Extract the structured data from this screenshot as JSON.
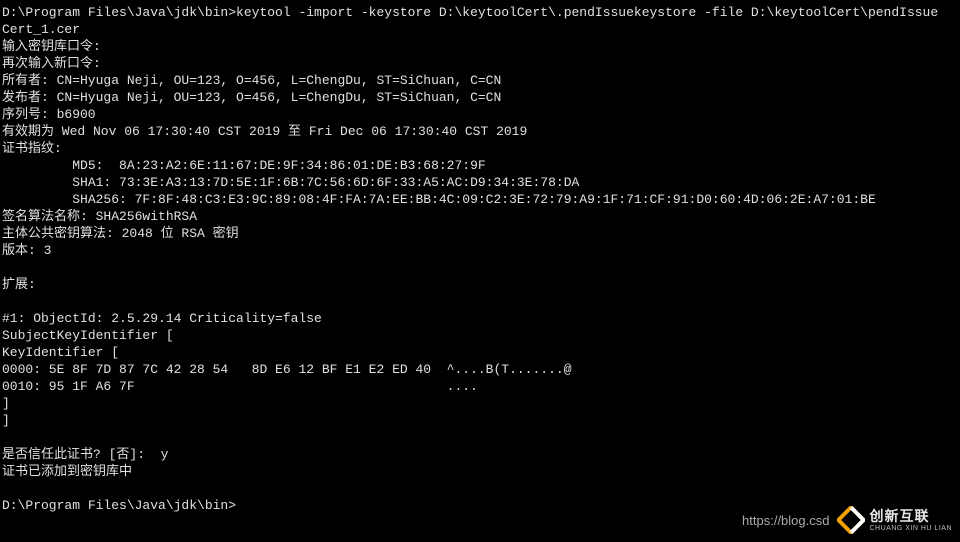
{
  "terminal": {
    "lines": [
      "D:\\Program Files\\Java\\jdk\\bin>keytool -import -keystore D:\\keytoolCert\\.pendIssuekeystore -file D:\\keytoolCert\\pendIssue",
      "Cert_1.cer",
      "输入密钥库口令:",
      "再次输入新口令:",
      "所有者: CN=Hyuga Neji, OU=123, O=456, L=ChengDu, ST=SiChuan, C=CN",
      "发布者: CN=Hyuga Neji, OU=123, O=456, L=ChengDu, ST=SiChuan, C=CN",
      "序列号: b6900",
      "有效期为 Wed Nov 06 17:30:40 CST 2019 至 Fri Dec 06 17:30:40 CST 2019",
      "证书指纹:",
      "         MD5:  8A:23:A2:6E:11:67:DE:9F:34:86:01:DE:B3:68:27:9F",
      "         SHA1: 73:3E:A3:13:7D:5E:1F:6B:7C:56:6D:6F:33:A5:AC:D9:34:3E:78:DA",
      "         SHA256: 7F:8F:48:C3:E3:9C:89:08:4F:FA:7A:EE:BB:4C:09:C2:3E:72:79:A9:1F:71:CF:91:D0:60:4D:06:2E:A7:01:BE",
      "签名算法名称: SHA256withRSA",
      "主体公共密钥算法: 2048 位 RSA 密钥",
      "版本: 3",
      "",
      "扩展:",
      "",
      "#1: ObjectId: 2.5.29.14 Criticality=false",
      "SubjectKeyIdentifier [",
      "KeyIdentifier [",
      "0000: 5E 8F 7D 87 7C 42 28 54   8D E6 12 BF E1 E2 ED 40  ^....B(T.......@",
      "0010: 95 1F A6 7F                                        ....",
      "]",
      "]",
      "",
      "是否信任此证书? [否]:  y",
      "证书已添加到密钥库中",
      "",
      "D:\\Program Files\\Java\\jdk\\bin>"
    ]
  },
  "watermark": {
    "url": "https://blog.csd",
    "brand_cn": "创新互联",
    "brand_en": "CHUANG XIN HU LIAN"
  }
}
